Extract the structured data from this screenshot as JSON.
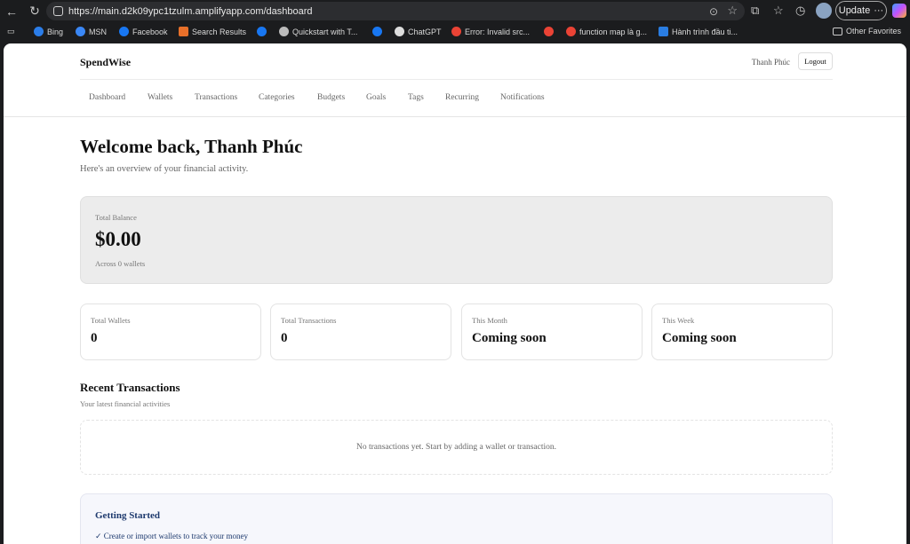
{
  "browser": {
    "url": "https://main.d2k09ypc1tzulm.amplifyapp.com/dashboard",
    "update_label": "Update",
    "update_more": "···",
    "bookmarks": [
      {
        "label": "Bing",
        "color": "#2b7de9"
      },
      {
        "label": "MSN",
        "color": "#3a87f5"
      },
      {
        "label": "Facebook",
        "color": "#1877f2"
      },
      {
        "label": "Search Results",
        "color": "#e8702a"
      },
      {
        "label": "",
        "color": "#1877f2"
      },
      {
        "label": "Quickstart with T...",
        "color": "#bbbbbb"
      },
      {
        "label": "",
        "color": "#1877f2"
      },
      {
        "label": "ChatGPT",
        "color": "#dddddd"
      },
      {
        "label": "Error: Invalid src...",
        "color": "#ea4335"
      },
      {
        "label": "",
        "color": "#ea4335"
      },
      {
        "label": "function map là g...",
        "color": "#ea4335"
      },
      {
        "label": "Hành trình đầu ti...",
        "color": "#2a7de1"
      }
    ],
    "other_favorites": "Other Favorites"
  },
  "header": {
    "brand": "SpendWise",
    "user_name": "Thanh Phúc",
    "logout_label": "Logout"
  },
  "nav": [
    "Dashboard",
    "Wallets",
    "Transactions",
    "Categories",
    "Budgets",
    "Goals",
    "Tags",
    "Recurring",
    "Notifications"
  ],
  "welcome": {
    "title": "Welcome back, Thanh Phúc",
    "subtitle": "Here's an overview of your financial activity."
  },
  "balance": {
    "label": "Total Balance",
    "amount": "$0.00",
    "sub": "Across 0 wallets"
  },
  "stats": [
    {
      "label": "Total Wallets",
      "value": "0"
    },
    {
      "label": "Total Transactions",
      "value": "0"
    },
    {
      "label": "This Month",
      "value": "Coming soon"
    },
    {
      "label": "This Week",
      "value": "Coming soon"
    }
  ],
  "recent": {
    "title": "Recent Transactions",
    "subtitle": "Your latest financial activities",
    "empty": "No transactions yet. Start by adding a wallet or transaction."
  },
  "getting_started": {
    "title": "Getting Started",
    "item1": "✓ Create or import wallets to track your money"
  }
}
